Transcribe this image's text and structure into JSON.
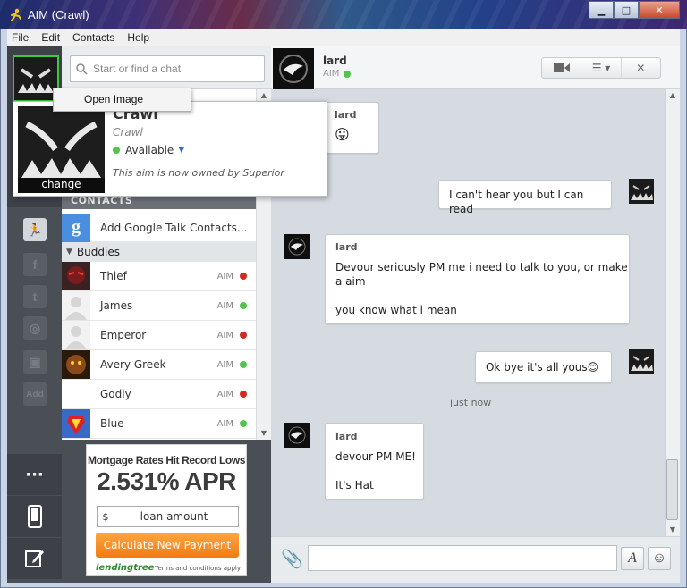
{
  "window": {
    "title": "AIM (Crawl)"
  },
  "menu": [
    "File",
    "Edit",
    "Contacts",
    "Help"
  ],
  "search": {
    "placeholder": "Start or find a chat"
  },
  "context_menu": {
    "item": "Open Image"
  },
  "profile": {
    "name": "Crawl",
    "subname": "Crawl",
    "status": "Available",
    "message": "This aim is now owned by Superior",
    "change_label": "change"
  },
  "contacts": {
    "section_label": "CONTACTS",
    "google_label": "Add Google Talk Contacts...",
    "group_name": "Buddies",
    "buddies": [
      {
        "name": "Thief",
        "service": "AIM",
        "status": "red"
      },
      {
        "name": "James",
        "service": "AIM",
        "status": "green"
      },
      {
        "name": "Emperor",
        "service": "AIM",
        "status": "red"
      },
      {
        "name": "Avery Greek",
        "service": "AIM",
        "status": "green"
      },
      {
        "name": "Godly",
        "service": "AIM",
        "status": "red"
      },
      {
        "name": "Blue",
        "service": "AIM",
        "status": "green"
      }
    ]
  },
  "ad": {
    "headline": "Mortgage Rates Hit Record Lows",
    "apr": "2.531% APR",
    "currency": "$",
    "input_placeholder": "loan amount",
    "button": "Calculate New Payment",
    "logo": "lendingtree",
    "terms": "Terms and conditions apply"
  },
  "chat": {
    "buddy_name": "lard",
    "service": "AIM",
    "messages": [
      {
        "from": "lard",
        "lines": [
          "😛"
        ]
      },
      {
        "from": "me",
        "lines": [
          "I can't hear you but I can read"
        ]
      },
      {
        "from": "lard",
        "lines": [
          "Devour seriously PM me i need to talk to you, or make",
          "a aim",
          "",
          "you know what i mean"
        ]
      },
      {
        "from": "me",
        "lines": [
          "Ok bye it's all yous😊"
        ]
      },
      {
        "from": "lard",
        "lines": [
          "devour PM ME!",
          "",
          "It's Hat"
        ]
      }
    ],
    "timestamp": "just now"
  },
  "colors": {
    "online": "#4fc54a",
    "away": "#d12a22",
    "accent_orange": "#f07c10"
  }
}
